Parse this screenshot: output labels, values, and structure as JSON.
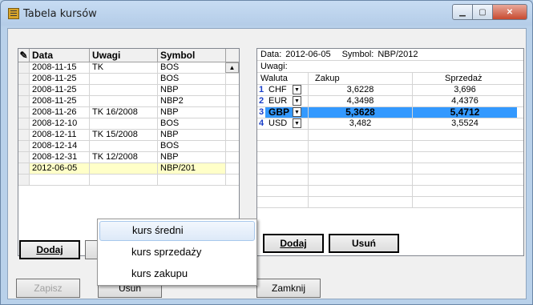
{
  "window": {
    "title": "Tabela kursów"
  },
  "left_grid": {
    "columns": [
      "Data",
      "Uwagi",
      "Symbol"
    ],
    "rows": [
      {
        "data": "2008-11-15",
        "uwagi": "TK",
        "symbol": "BOŚ"
      },
      {
        "data": "2008-11-25",
        "uwagi": "",
        "symbol": "BOŚ"
      },
      {
        "data": "2008-11-25",
        "uwagi": "",
        "symbol": "NBP"
      },
      {
        "data": "2008-11-25",
        "uwagi": "",
        "symbol": "NBP2"
      },
      {
        "data": "2008-11-26",
        "uwagi": "TK 16/2008",
        "symbol": "NBP"
      },
      {
        "data": "2008-12-10",
        "uwagi": "",
        "symbol": "BOŚ"
      },
      {
        "data": "2008-12-11",
        "uwagi": "TK 15/2008",
        "symbol": "NBP"
      },
      {
        "data": "2008-12-14",
        "uwagi": "",
        "symbol": "BOŚ"
      },
      {
        "data": "2008-12-31",
        "uwagi": "TK 12/2008",
        "symbol": "NBP"
      },
      {
        "data": "2012-06-05",
        "uwagi": "",
        "symbol": "NBP/201"
      }
    ],
    "add_button": "Dodaj"
  },
  "right_panel": {
    "data_label": "Data:",
    "data_value": "2012-06-05",
    "symbol_label": "Symbol:",
    "symbol_value": "NBP/2012",
    "uwagi_label": "Uwagi:",
    "columns": [
      "Waluta",
      "Zakup",
      "Sprzedaż"
    ],
    "rows": [
      {
        "num": "1",
        "waluta": "CHF",
        "zakup": "3,6228",
        "sprzedaz": "3,696"
      },
      {
        "num": "2",
        "waluta": "EUR",
        "zakup": "4,3498",
        "sprzedaz": "4,4376"
      },
      {
        "num": "3",
        "waluta": "GBP",
        "zakup": "5,3628",
        "sprzedaz": "5,4712"
      },
      {
        "num": "4",
        "waluta": "USD",
        "zakup": "3,482",
        "sprzedaz": "3,5524"
      }
    ],
    "add_button": "Dodaj",
    "delete_button": "Usuń"
  },
  "bottom": {
    "save_button": "Zapisz",
    "delete_button": "Usuń",
    "exit_button": "Zamknij"
  },
  "context_menu": {
    "items": [
      "kurs średni",
      "kurs sprzedaży",
      "kurs zakupu"
    ]
  }
}
